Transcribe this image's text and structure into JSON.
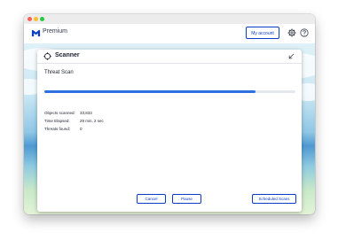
{
  "app": {
    "product_name": "Premium",
    "account_button": "My account",
    "icons": {
      "logo": "malwarebytes-logo-icon",
      "settings": "gear-icon",
      "help": "help-circle-icon"
    }
  },
  "scanner": {
    "title": "Scanner",
    "scan_title": "Threat Scan",
    "progress_fraction": 0.84,
    "stats": [
      {
        "label": "Objects scanned:",
        "value": "33,833"
      },
      {
        "label": "Time Elapsed:",
        "value": "29 min, 2 sec"
      },
      {
        "label": "Threats found:",
        "value": "0"
      }
    ],
    "buttons": {
      "cancel": "Cancel",
      "pause": "Pause",
      "scheduled": "Scheduled Scans"
    }
  },
  "colors": {
    "accent": "#0a3dc6",
    "progress": "#2f6fe0"
  }
}
